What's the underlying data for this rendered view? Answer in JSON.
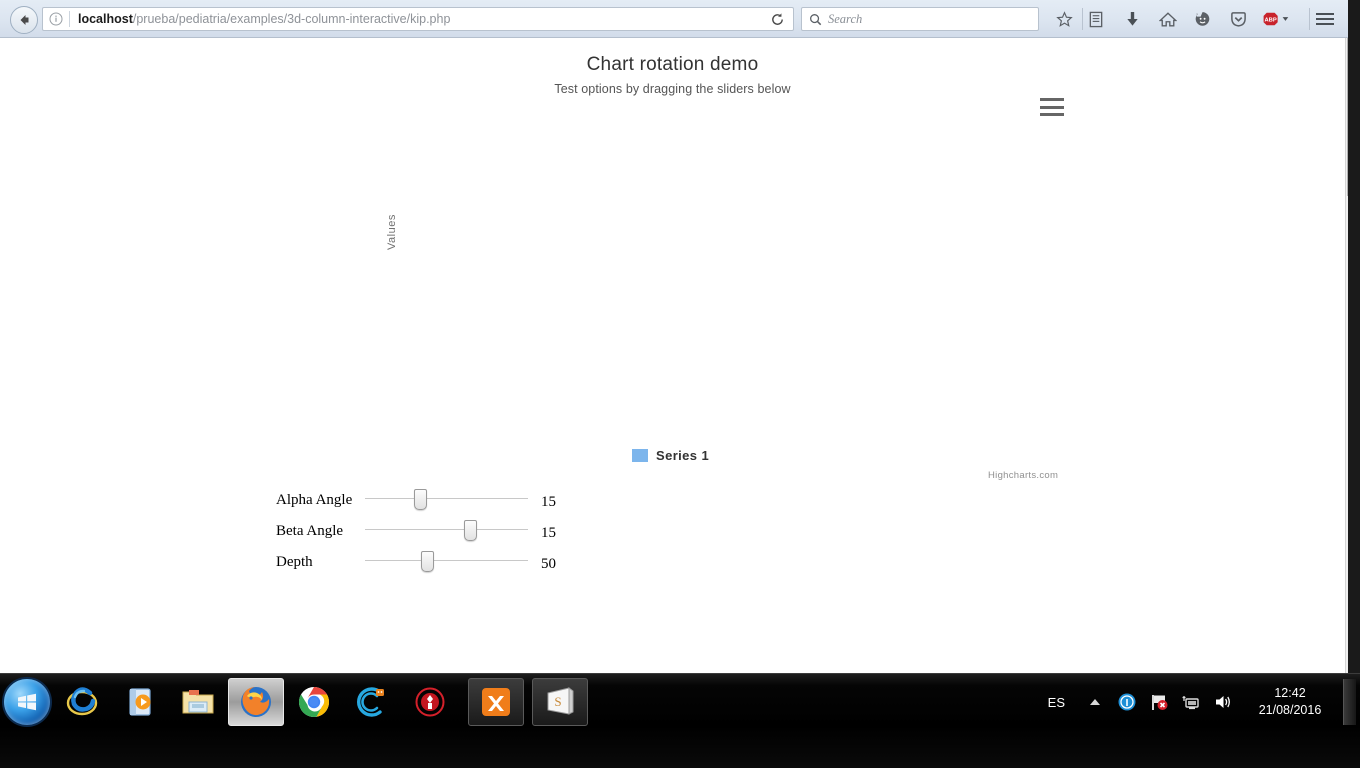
{
  "browser": {
    "back_button": "Back",
    "url": {
      "host": "localhost",
      "path": "/prueba/pediatria/examples/3d-column-interactive/kip.php",
      "full": "localhost/prueba/pediatria/examples/3d-column-interactive/kip.php"
    },
    "reload_label": "Reload",
    "search": {
      "placeholder": "Search",
      "value": ""
    },
    "toolbar_icons": [
      {
        "name": "bookmark-star-icon",
        "label": "Bookmark this page"
      },
      {
        "name": "library-icon",
        "label": "Show your bookmarks"
      },
      {
        "name": "downloads-icon",
        "label": "Downloads"
      },
      {
        "name": "home-icon",
        "label": "Home"
      },
      {
        "name": "sync-smiley-icon",
        "label": "Sync"
      },
      {
        "name": "pocket-icon",
        "label": "Save to Pocket"
      },
      {
        "name": "adblock-plus-icon",
        "label": "ABP"
      },
      {
        "name": "hamburger-menu-icon",
        "label": "Open menu"
      }
    ]
  },
  "chart": {
    "title": "Chart rotation demo",
    "subtitle": "Test options by dragging the sliders below",
    "yaxis_title": "Values",
    "credits": "Highcharts.com",
    "export_menu_label": "Chart context menu",
    "legend": [
      {
        "name": "Series 1",
        "color": "#7cb5ec"
      }
    ]
  },
  "chart_data": {
    "type": "bar",
    "title": "Chart rotation demo",
    "subtitle": "Test options by dragging the sliders below",
    "xlabel": "",
    "ylabel": "Values",
    "categories": [],
    "series": [
      {
        "name": "Series 1",
        "color": "#7cb5ec",
        "values": []
      }
    ],
    "legend_position": "bottom",
    "grid": false,
    "credits": "Highcharts.com",
    "options_3d": {
      "alpha": 15,
      "beta": 15,
      "depth": 50
    }
  },
  "sliders": [
    {
      "name": "alpha-angle",
      "label": "Alpha Angle",
      "value": "15",
      "min": 0,
      "max": 45,
      "percent": 34
    },
    {
      "name": "beta-angle",
      "label": "Beta Angle",
      "value": "15",
      "min": -45,
      "max": 45,
      "percent": 65
    },
    {
      "name": "depth",
      "label": "Depth",
      "value": "50",
      "min": 20,
      "max": 100,
      "percent": 38
    }
  ],
  "taskbar": {
    "start_label": "Start",
    "items": [
      {
        "name": "internet-explorer-icon",
        "label": "Internet Explorer"
      },
      {
        "name": "media-player-icon",
        "label": "Windows Media Player"
      },
      {
        "name": "file-explorer-icon",
        "label": "Windows Explorer"
      },
      {
        "name": "firefox-icon",
        "label": "Mozilla Firefox",
        "active": true
      },
      {
        "name": "chrome-icon",
        "label": "Google Chrome"
      },
      {
        "name": "ccleaner-icon",
        "label": "CCleaner"
      },
      {
        "name": "antivirus-icon",
        "label": "Antivirus"
      },
      {
        "name": "xampp-icon",
        "label": "XAMPP Control Panel"
      },
      {
        "name": "sublime-text-icon",
        "label": "Sublime Text"
      }
    ],
    "tray": {
      "language": "ES",
      "icons": [
        {
          "name": "show-hidden-icons-icon",
          "label": "Show hidden icons"
        },
        {
          "name": "security-shield-icon",
          "label": "Security"
        },
        {
          "name": "flag-action-center-icon",
          "label": "Action Center"
        },
        {
          "name": "network-icon",
          "label": "Network"
        },
        {
          "name": "volume-icon",
          "label": "Volume"
        }
      ],
      "time": "12:42",
      "date": "21/08/2016"
    }
  }
}
